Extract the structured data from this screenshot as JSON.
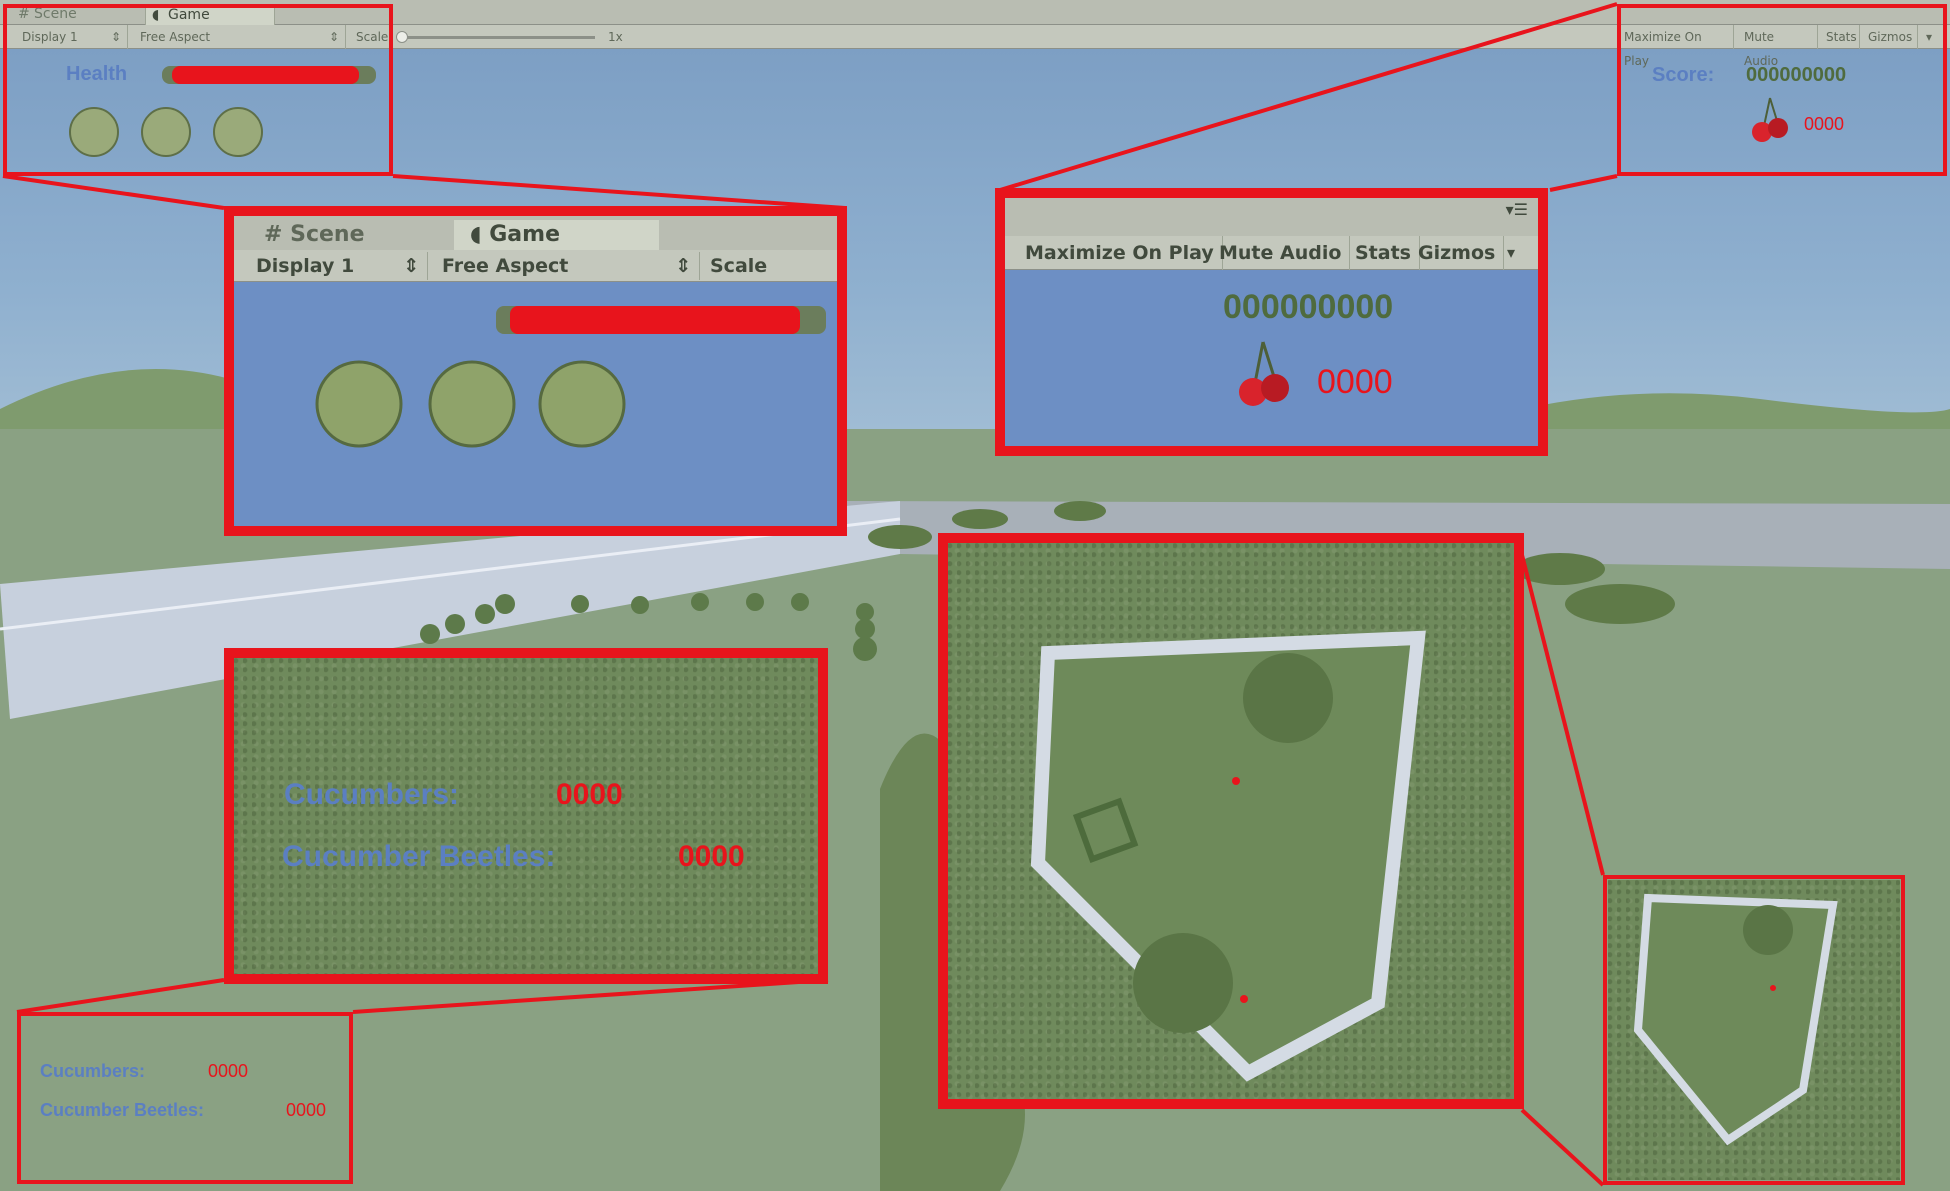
{
  "editor": {
    "tabs": [
      {
        "label": "Scene",
        "icon": "grid-icon",
        "active": false
      },
      {
        "label": "Game",
        "icon": "pacman-icon",
        "active": true
      }
    ],
    "display": "Display 1",
    "aspect": "Free Aspect",
    "scale_label": "Scale",
    "scale_value": "1x",
    "buttons": [
      "Maximize On Play",
      "Mute Audio",
      "Stats",
      "Gizmos"
    ]
  },
  "hud": {
    "health_label": "Health",
    "health_level": 0.92,
    "lives": 3,
    "score_label": "Score:",
    "score_value": "000000000",
    "cherry_count": "0000",
    "cucumbers_label": "Cucumbers:",
    "cucumbers_value": "0000",
    "beetles_label": "Cucumber Beetles:",
    "beetles_value": "0000"
  },
  "colors": {
    "callout": "#e8141c",
    "hud_blue": "#5b7fc2",
    "hud_red": "#e8141c",
    "score_green": "#4f6b3e"
  }
}
